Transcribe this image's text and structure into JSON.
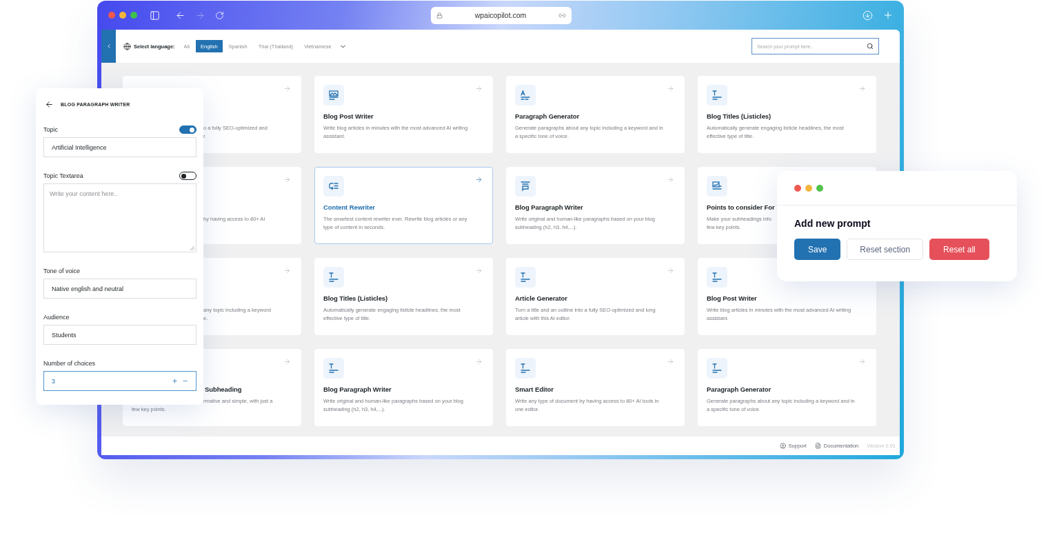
{
  "browser": {
    "url": "wpaicopilot.com",
    "forward_disabled": true
  },
  "language_filter": {
    "label": "Select language:",
    "options": [
      {
        "label": "All",
        "selected": false
      },
      {
        "label": "English",
        "selected": true
      },
      {
        "label": "Spanish",
        "selected": false
      },
      {
        "label": "Thai (Thailand)",
        "selected": false
      },
      {
        "label": "Vietnamese",
        "selected": false
      }
    ]
  },
  "search": {
    "placeholder": "Search your prompt here.."
  },
  "cards": [
    {
      "kind": "covered",
      "lines": [
        "o a fully SEO-optimized and",
        "r."
      ]
    },
    {
      "kind": "full",
      "title": "Blog Post Writer",
      "description": "Write blog articles in minutes with the most advanced AI writing assistant.",
      "selected": false
    },
    {
      "kind": "full",
      "title": "Paragraph Generator",
      "description": "Generate paragraphs about any topic including a keyword and in a specific tone of voice.",
      "selected": false
    },
    {
      "kind": "full",
      "title": "Blog Titles (Listicles)",
      "description": "Automatically generate engaging listicle headlines, the most effective type of title.",
      "selected": false
    },
    {
      "kind": "covered",
      "lines": [
        "by having access to 80+ AI"
      ]
    },
    {
      "kind": "full",
      "title": "Content Rewriter",
      "description": "The smartest content rewriter ever. Rewrite blog articles or any type of content in seconds.",
      "selected": true
    },
    {
      "kind": "full",
      "title": "Blog Paragraph Writer",
      "description": "Write original and human-like paragraphs based on your blog subheading (h2, h3, h4,...).",
      "selected": false
    },
    {
      "kind": "full",
      "title": "Points to consider For",
      "lines": [
        "Make your subheadings info",
        "few key points."
      ],
      "selected": false
    },
    {
      "kind": "covered",
      "lines": [
        "any topic including a keyword",
        "e."
      ]
    },
    {
      "kind": "full",
      "title": "Blog Titles (Listicles)",
      "description": "Automatically generate engaging listicle headlines, the most effective type of title.",
      "selected": false
    },
    {
      "kind": "full",
      "title": "Article Generator",
      "description": "Turn a title and an outline into a fully SEO-optimized and long article with this AI editor.",
      "selected": false
    },
    {
      "kind": "full",
      "title": "Blog Post Writer",
      "description": "Write blog articles in minutes with the most advanced AI writing assistant.",
      "selected": false
    },
    {
      "kind": "covered",
      "title": "Subheading",
      "lines": [
        "rmative and simple, with just a"
      ],
      "tail": "few key points."
    },
    {
      "kind": "full",
      "title": "Blog Paragraph Writer",
      "description": "Write original and human-like paragraphs based on your blog subheading (h2, h3, h4,...).",
      "selected": false
    },
    {
      "kind": "full",
      "title": "Smart Editor",
      "description": "Write any type of document by having access to 80+ AI tools in one editor.",
      "selected": false
    },
    {
      "kind": "full",
      "title": "Paragraph Generator",
      "description": "Generate paragraphs about any topic including a keyword and in a specific tone of voice.",
      "selected": false
    }
  ],
  "footer": {
    "links": [
      "Support",
      "Documentation"
    ],
    "version": "Version 0.01"
  },
  "form_panel": {
    "title": "BLOG PARAGRAPH WRITER",
    "fields": [
      {
        "kind": "text",
        "label": "Topic",
        "toggle": true,
        "value": "Artificial Intelligence"
      },
      {
        "kind": "textarea",
        "label": "Topic Textarea",
        "toggle": false,
        "placeholder": "Write your content here.."
      },
      {
        "kind": "text",
        "label": "Tone of voice",
        "value": "Native english and neutral"
      },
      {
        "kind": "text",
        "label": "Audience",
        "value": "Students"
      },
      {
        "kind": "number",
        "label": "Number of choices",
        "value": "3"
      }
    ]
  },
  "prompt_dialog": {
    "title": "Add new prompt",
    "buttons": [
      {
        "kind": "primary",
        "label": "Save"
      },
      {
        "kind": "outline",
        "label": "Reset section"
      },
      {
        "kind": "danger",
        "label": "Reset all"
      }
    ]
  }
}
